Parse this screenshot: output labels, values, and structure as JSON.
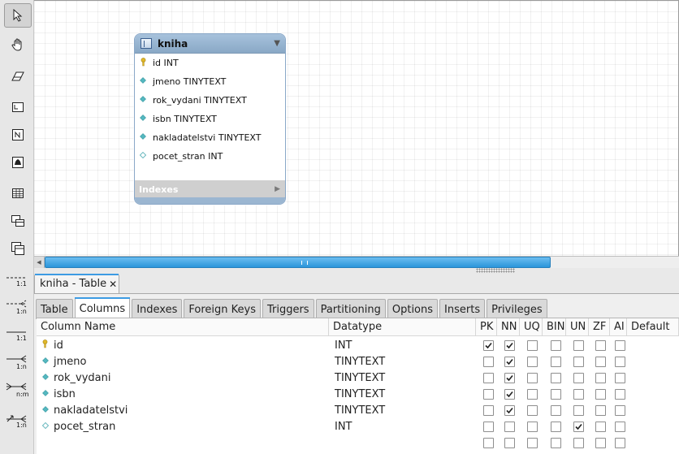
{
  "canvas": {
    "table": {
      "name": "kniha",
      "columns": [
        {
          "label": "id INT",
          "icon": "key-icon"
        },
        {
          "label": "jmeno TINYTEXT",
          "icon": "filled-diamond-icon"
        },
        {
          "label": "rok_vydani TINYTEXT",
          "icon": "filled-diamond-icon"
        },
        {
          "label": "isbn TINYTEXT",
          "icon": "filled-diamond-icon"
        },
        {
          "label": "nakladatelstvi TINYTEXT",
          "icon": "filled-diamond-icon"
        },
        {
          "label": "pocet_stran INT",
          "icon": "empty-diamond-icon"
        }
      ],
      "indexes_label": "Indexes"
    }
  },
  "toolbar": {
    "relations": [
      {
        "label": "1:1",
        "kind": "one-to-one"
      },
      {
        "label": "1:n",
        "kind": "one-to-many"
      },
      {
        "label": "1:1",
        "kind": "one-to-one-identifying"
      },
      {
        "label": "1:n",
        "kind": "one-to-many-identifying"
      },
      {
        "label": "n:m",
        "kind": "many-to-many"
      },
      {
        "label": "1:n",
        "kind": "one-to-many-existing"
      }
    ]
  },
  "editor": {
    "tab_title": "kniha - Table",
    "close_glyph": "✕",
    "subtabs": [
      "Table",
      "Columns",
      "Indexes",
      "Foreign Keys",
      "Triggers",
      "Partitioning",
      "Options",
      "Inserts",
      "Privileges"
    ],
    "active_subtab": "Columns",
    "grid": {
      "headers": [
        "Column Name",
        "Datatype",
        "PK",
        "NN",
        "UQ",
        "BIN",
        "UN",
        "ZF",
        "AI",
        "Default"
      ],
      "rows": [
        {
          "name": "id",
          "type": "INT",
          "icon": "key-icon",
          "flags": [
            1,
            1,
            0,
            0,
            0,
            0,
            0
          ]
        },
        {
          "name": "jmeno",
          "type": "TINYTEXT",
          "icon": "filled-diamond-icon",
          "flags": [
            0,
            1,
            0,
            0,
            0,
            0,
            0
          ]
        },
        {
          "name": "rok_vydani",
          "type": "TINYTEXT",
          "icon": "filled-diamond-icon",
          "flags": [
            0,
            1,
            0,
            0,
            0,
            0,
            0
          ]
        },
        {
          "name": "isbn",
          "type": "TINYTEXT",
          "icon": "filled-diamond-icon",
          "flags": [
            0,
            1,
            0,
            0,
            0,
            0,
            0
          ]
        },
        {
          "name": "nakladatelstvi",
          "type": "TINYTEXT",
          "icon": "filled-diamond-icon",
          "flags": [
            0,
            1,
            0,
            0,
            0,
            0,
            0
          ]
        },
        {
          "name": "pocet_stran",
          "type": "INT",
          "icon": "empty-diamond-icon",
          "flags": [
            0,
            0,
            0,
            0,
            1,
            0,
            0
          ]
        },
        {
          "name": "",
          "type": "",
          "icon": "",
          "flags": [
            0,
            0,
            0,
            0,
            0,
            0,
            0
          ]
        }
      ]
    }
  },
  "colors": {
    "accent": "#3d9be3",
    "table_header": "#89a8c6",
    "scroll_thumb": "#2b95da"
  }
}
